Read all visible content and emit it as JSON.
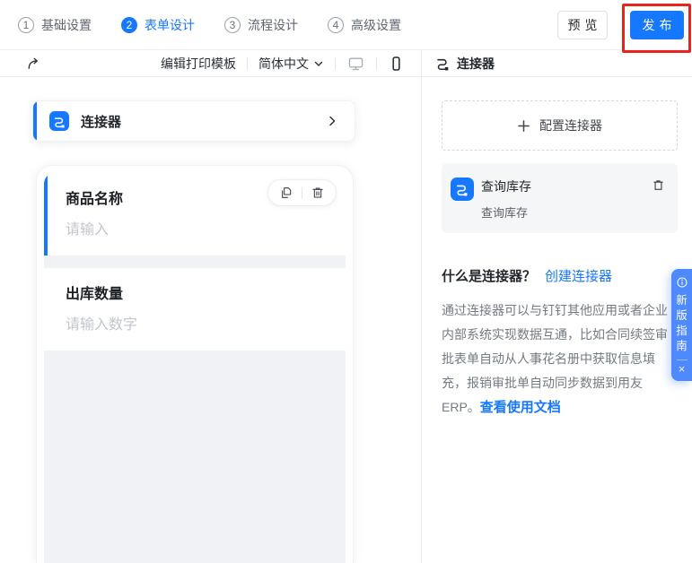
{
  "topbar": {
    "steps": [
      {
        "num": "1",
        "label": "基础设置"
      },
      {
        "num": "2",
        "label": "表单设计"
      },
      {
        "num": "3",
        "label": "流程设计"
      },
      {
        "num": "4",
        "label": "高级设置"
      }
    ],
    "active_step": "2",
    "preview_label": "预览",
    "publish_label": "发布"
  },
  "toolbar": {
    "edit_print_template": "编辑打印模板",
    "language": "简体中文",
    "redo_icon": "redo-arrow",
    "desktop_icon": "monitor",
    "mobile_icon": "smartphone"
  },
  "canvas": {
    "connector_entry_label": "连接器",
    "fields": [
      {
        "label": "商品名称",
        "placeholder": "请输入"
      },
      {
        "label": "出库数量",
        "placeholder": "请输入数字"
      }
    ]
  },
  "right_panel": {
    "header": "连接器",
    "config_button_label": "配置连接器",
    "connector_item": {
      "title": "查询库存",
      "subtitle": "查询库存"
    },
    "what_is_label": "什么是连接器？",
    "create_link": "创建连接器",
    "description": "通过连接器可以与钉钉其他应用或者企业内部系统实现数据互通，比如合同续签审批表单自动从人事花名册中获取信息填充，报销审批单自动同步数据到用友ERP。",
    "doc_link": "查看使用文档",
    "guide_tab": {
      "label": "新版指南",
      "close": "×"
    }
  },
  "colors": {
    "primary": "#1677ff",
    "red": "#e8231a",
    "guide-blue": "#4e89fd"
  }
}
